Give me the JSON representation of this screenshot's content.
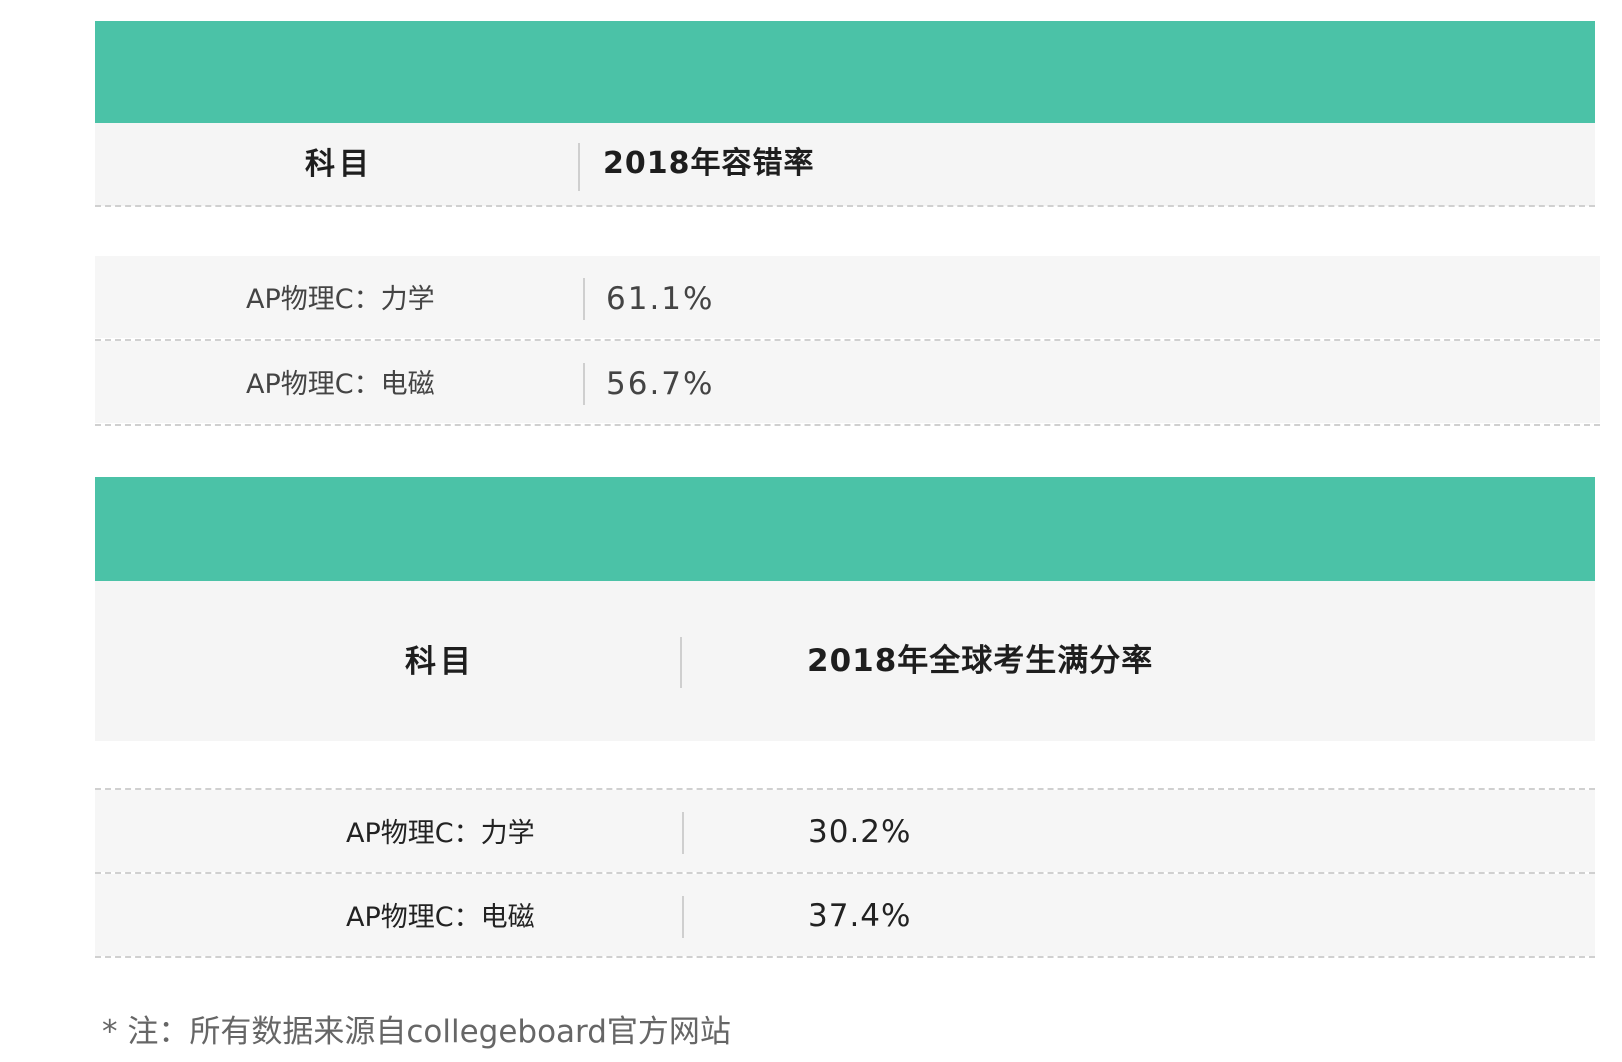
{
  "table1": {
    "headers": [
      "科目",
      "2018年容错率"
    ],
    "rows": [
      {
        "subject": "AP物理C：力学",
        "value": "61.1%"
      },
      {
        "subject": "AP物理C：电磁",
        "value": "56.7%"
      }
    ]
  },
  "table2": {
    "headers": [
      "科目",
      "2018年全球考生满分率"
    ],
    "rows": [
      {
        "subject": "AP物理C：力学",
        "value": "30.2%"
      },
      {
        "subject": "AP物理C：电磁",
        "value": "37.4%"
      }
    ]
  },
  "footnote": "* 注：所有数据来源自collegeboard官方网站",
  "colors": {
    "accent": "#4bc2a7",
    "header_bg": "#f5f5f5",
    "row_bg": "#f6f6f6"
  }
}
